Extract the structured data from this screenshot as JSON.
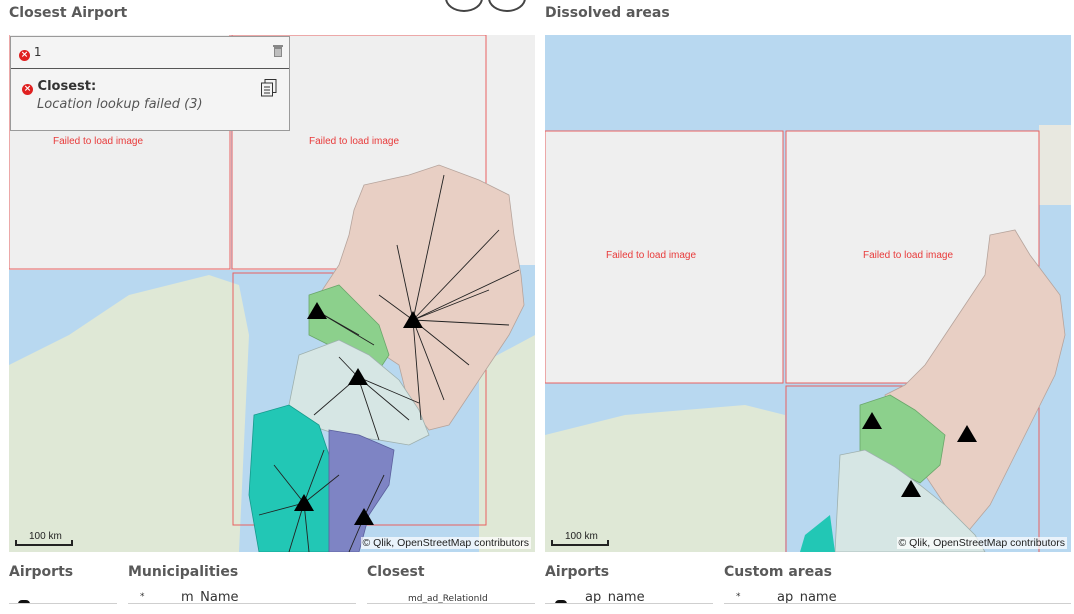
{
  "left_panel": {
    "title": "Closest Airport",
    "failed_text": "Failed to load image",
    "scale": "100 km",
    "attribution": "© Qlik, OpenStreetMap contributors",
    "popup": {
      "count": "1",
      "closest_label": "Closest:",
      "error_text": "Location lookup failed (3)"
    }
  },
  "right_panel": {
    "title": "Dissolved areas",
    "failed_text": "Failed to load image",
    "scale": "100 km",
    "attribution": "© Qlik, OpenStreetMap contributors"
  },
  "bottom": {
    "airports_title": "Airports",
    "municipalities_title": "Municipalities",
    "municipalities_col": "m_Name",
    "closest_title": "Closest",
    "closest_col": "md_ad_RelationId",
    "airports2_title": "Airports",
    "airports2_col": "ap_name",
    "custom_areas_title": "Custom areas",
    "custom_areas_col": "ap_name"
  },
  "colors": {
    "water": "#b8d8f0",
    "land": "#e8e8e0",
    "region_north": "#e8cfc4",
    "region_green": "#8cd08c",
    "region_pale": "#d6e6e4",
    "region_teal": "#22c7b5",
    "region_purple": "#7e84c4",
    "fail_border": "#e86060"
  }
}
